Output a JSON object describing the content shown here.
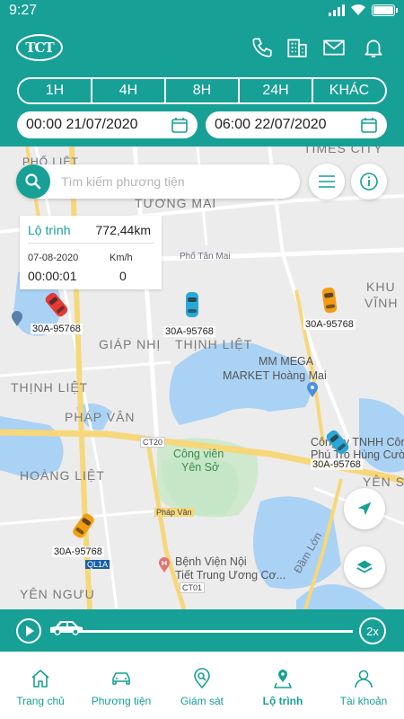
{
  "status_bar": {
    "time": "9:27"
  },
  "header": {
    "logo_text": "TCT",
    "icons": [
      "phone-icon",
      "building-icon",
      "mail-icon",
      "bell-icon"
    ]
  },
  "time_ranges": [
    "1H",
    "4H",
    "8H",
    "24H",
    "KHÁC"
  ],
  "date_from": "00:00 21/07/2020",
  "date_to": "06:00 22/07/2020",
  "search": {
    "placeholder": "Tìm kiếm phương tiện"
  },
  "info_card": {
    "route_label": "Lộ trình",
    "distance": "772,44km",
    "date": "07-08-2020",
    "speed_unit": "Km/h",
    "duration": "00:00:01",
    "speed": "0"
  },
  "map": {
    "labels": [
      "TIMES CITY",
      "PHỐ LIỆT",
      "TƯƠNG MAI",
      "Phố Tân Mai",
      "KHU",
      "VĨNH",
      "GIÁP NHỊ",
      "THỊNH LIỆT",
      "THỊNH LIỆT",
      "PHÁP VÂN",
      "HOÀNG LIỆT",
      "YÊN NGƯU",
      "YÊN SỞ",
      "Đầm Lớn",
      "Pháp Vân",
      "CT20",
      "CT01",
      "QL1A"
    ],
    "pois": [
      "MM MEGA",
      "MARKET Hoàng Mai",
      "Công ty TNHH Công",
      "Phú Trọ Hùng Cườ",
      "Công viên",
      "Yên Sở",
      "Bệnh Viện Nội",
      "Tiết Trung Ương Cơ..."
    ]
  },
  "vehicles": [
    {
      "plate": "30A-95768",
      "color": "#e53935"
    },
    {
      "plate": "30A-95768",
      "color": "#29a8d8"
    },
    {
      "plate": "30A-95768",
      "color": "#f39c12"
    },
    {
      "plate": "30A-95768",
      "color": "#29a8d8"
    },
    {
      "plate": "30A-95768",
      "color": "#f39c12"
    }
  ],
  "playback": {
    "speed": "2x"
  },
  "nav": [
    {
      "label": "Trang chủ",
      "icon": "home-icon"
    },
    {
      "label": "Phương tiện",
      "icon": "car-icon"
    },
    {
      "label": "Giám sát",
      "icon": "map-search-icon"
    },
    {
      "label": "Lộ trình",
      "icon": "route-icon",
      "active": true
    },
    {
      "label": "Tài khoản",
      "icon": "user-icon"
    }
  ],
  "colors": {
    "primary": "#17a096",
    "water": "#aad2f4",
    "park": "#c7e8c6",
    "road_major": "#f6d77a"
  }
}
